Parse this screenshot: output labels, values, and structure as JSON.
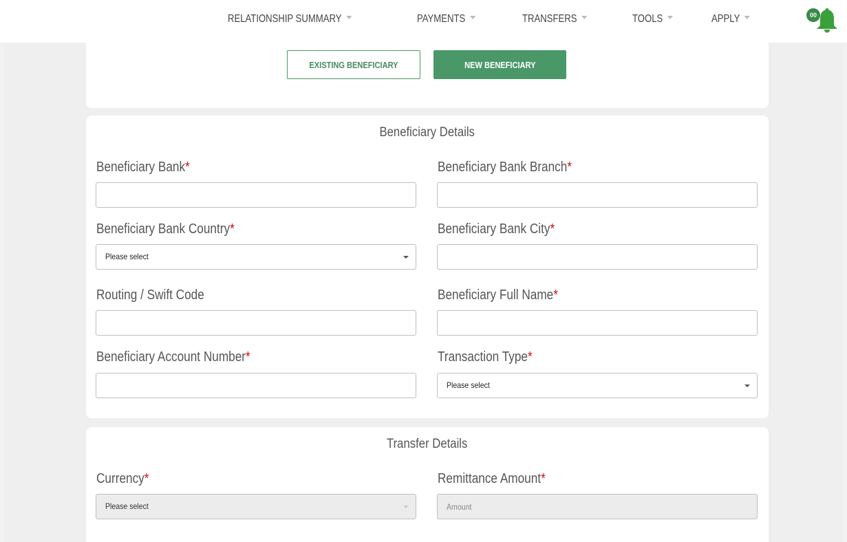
{
  "nav": {
    "items": [
      {
        "label": "RELATIONSHIP SUMMARY"
      },
      {
        "label": "PAYMENTS"
      },
      {
        "label": "TRANSFERS"
      },
      {
        "label": "TOOLS"
      },
      {
        "label": "APPLY"
      }
    ],
    "notification_count": "00",
    "notification_icon": "bell-icon",
    "accent_color": "#3a9a3a"
  },
  "beneficiary_toggle": {
    "existing_label": "EXISTING BENEFICIARY",
    "new_label": "NEW BENEFICIARY",
    "active": "new"
  },
  "beneficiary_details": {
    "title": "Beneficiary Details",
    "required_mark": "*",
    "fields": {
      "bank": {
        "label": "Beneficiary Bank",
        "value": ""
      },
      "bank_branch": {
        "label": "Beneficiary Bank Branch",
        "value": ""
      },
      "bank_country": {
        "label": "Beneficiary Bank Country",
        "selected": "Please select"
      },
      "bank_city": {
        "label": "Beneficiary Bank City",
        "value": ""
      },
      "routing_swift": {
        "label": "Routing / Swift Code",
        "value": ""
      },
      "full_name": {
        "label": "Beneficiary Full Name",
        "value": ""
      },
      "account_number": {
        "label": "Beneficiary Account Number",
        "value": ""
      },
      "transaction_type": {
        "label": "Transaction Type",
        "selected": "Please select"
      }
    }
  },
  "transfer_details": {
    "title": "Transfer Details",
    "fields": {
      "currency": {
        "label": "Currency",
        "selected": "Please select"
      },
      "remittance_amount": {
        "label": "Remittance Amount",
        "placeholder": "Amount"
      }
    }
  },
  "colors": {
    "primary_green": "#4a9868",
    "required_red": "#d01010"
  }
}
